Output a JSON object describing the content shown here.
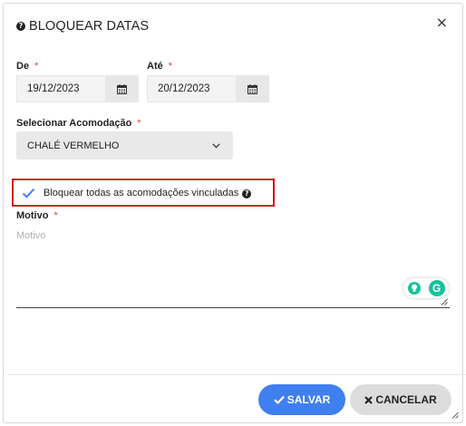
{
  "modal": {
    "title": "BLOQUEAR DATAS",
    "close_glyph": "×"
  },
  "form": {
    "de": {
      "label": "De",
      "required_mark": "*",
      "value": "19/12/2023"
    },
    "ate": {
      "label": "Até",
      "required_mark": "*",
      "value": "20/12/2023"
    },
    "acomodacao": {
      "label": "Selecionar Acomodação",
      "required_mark": "*",
      "selected": "CHALÉ VERMELHO"
    },
    "bloquear_todas": {
      "label": "Bloquear todas as acomodações vinculadas",
      "checked": true
    },
    "motivo": {
      "label": "Motivo",
      "required_mark": "*",
      "placeholder": "Motivo",
      "value": ""
    }
  },
  "extension": {
    "grammarly_letter": "G"
  },
  "footer": {
    "save_label": "SALVAR",
    "cancel_label": "CANCELAR"
  },
  "colors": {
    "primary": "#3f7ff0",
    "required": "#e53935",
    "highlight_border": "#d0151b",
    "grammarly": "#15c39a"
  },
  "icons": [
    "help-icon",
    "close-icon",
    "calendar-icon",
    "chevron-down-icon",
    "checkmark-icon",
    "lightbulb-icon",
    "grammarly-icon",
    "resize-grip-icon",
    "times-icon"
  ]
}
